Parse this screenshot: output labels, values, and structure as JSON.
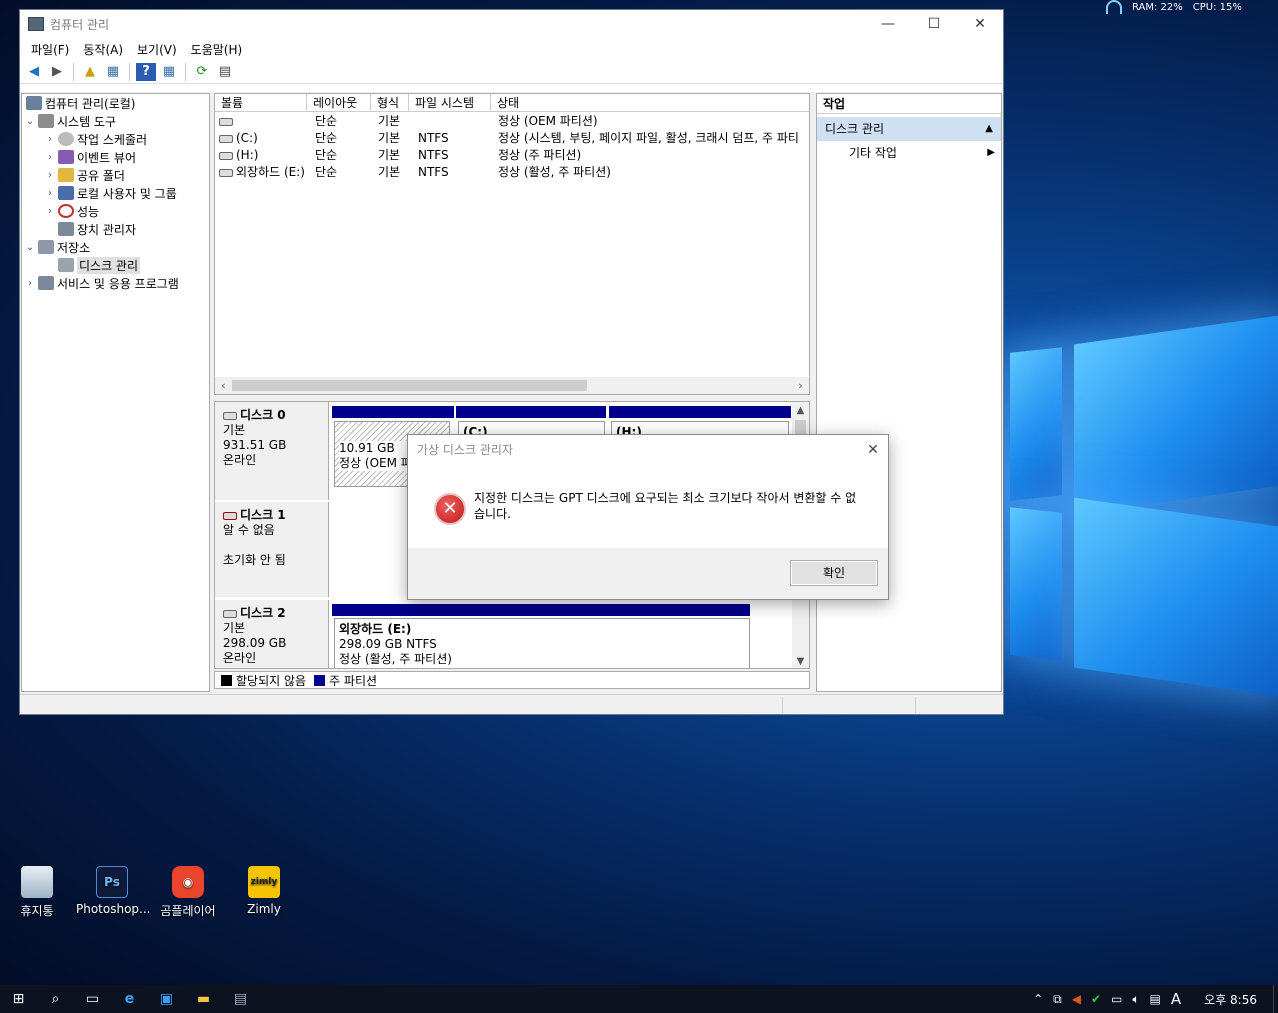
{
  "sysmon": {
    "ram": "RAM: 22%",
    "cpu": "CPU: 15%"
  },
  "window": {
    "title": "컴퓨터 관리",
    "menu": [
      "파일(F)",
      "동작(A)",
      "보기(V)",
      "도움말(H)"
    ]
  },
  "tree": {
    "root": "컴퓨터 관리(로컬)",
    "system_tools": "시스템 도구",
    "task_scheduler": "작업 스케줄러",
    "event_viewer": "이벤트 뷰어",
    "shared_folders": "공유 폴더",
    "local_users": "로컬 사용자 및 그룹",
    "performance": "성능",
    "device_manager": "장치 관리자",
    "storage": "저장소",
    "disk_management": "디스크 관리",
    "services_apps": "서비스 및 응용 프로그램"
  },
  "volume_list": {
    "columns": [
      "볼륨",
      "레이아웃",
      "형식",
      "파일 시스템",
      "상태"
    ],
    "rows": [
      {
        "volume": "",
        "layout": "단순",
        "type": "기본",
        "fs": "",
        "status": "정상 (OEM 파티션)"
      },
      {
        "volume": "(C:)",
        "layout": "단순",
        "type": "기본",
        "fs": "NTFS",
        "status": "정상 (시스템, 부팅, 페이지 파일, 활성, 크래시 덤프, 주 파티"
      },
      {
        "volume": "(H:)",
        "layout": "단순",
        "type": "기본",
        "fs": "NTFS",
        "status": "정상 (주 파티션)"
      },
      {
        "volume": "외장하드 (E:)",
        "layout": "단순",
        "type": "기본",
        "fs": "NTFS",
        "status": "정상 (활성, 주 파티션)"
      }
    ]
  },
  "disks": {
    "disk0": {
      "name": "디스크 0",
      "type": "기본",
      "size": "931.51 GB",
      "state": "온라인",
      "part1_size": "10.91 GB",
      "part1_status": "정상 (OEM 파",
      "part2_label": "(C:)",
      "part3_label": "(H:)"
    },
    "disk1": {
      "name": "디스크 1",
      "state": "알 수 없음",
      "init": "초기화 안 됨"
    },
    "disk2": {
      "name": "디스크 2",
      "type": "기본",
      "size": "298.09 GB",
      "state": "온라인",
      "vol_name": "외장하드  (E:)",
      "vol_size": "298.09 GB NTFS",
      "vol_status": "정상 (활성, 주 파티션)"
    }
  },
  "legend": {
    "unallocated": "할당되지 않음",
    "primary": "주 파티션"
  },
  "actions": {
    "header": "작업",
    "section": "디스크 관리",
    "more": "기타 작업"
  },
  "dialog": {
    "title": "가상 디스크 관리자",
    "message": "지정한 디스크는 GPT 디스크에 요구되는 최소 크기보다 작아서 변환할 수 없습니다.",
    "ok": "확인"
  },
  "desktop_icons": [
    {
      "label": "휴지통"
    },
    {
      "label": "Photoshop..."
    },
    {
      "label": "곰플레이어"
    },
    {
      "label": "Zimly"
    }
  ],
  "taskbar": {
    "time": "오후 8:56",
    "ime": "A"
  },
  "colors": {
    "primary_partition": "#00008b",
    "unallocated": "#000000",
    "accent": "#cfe0f2"
  }
}
